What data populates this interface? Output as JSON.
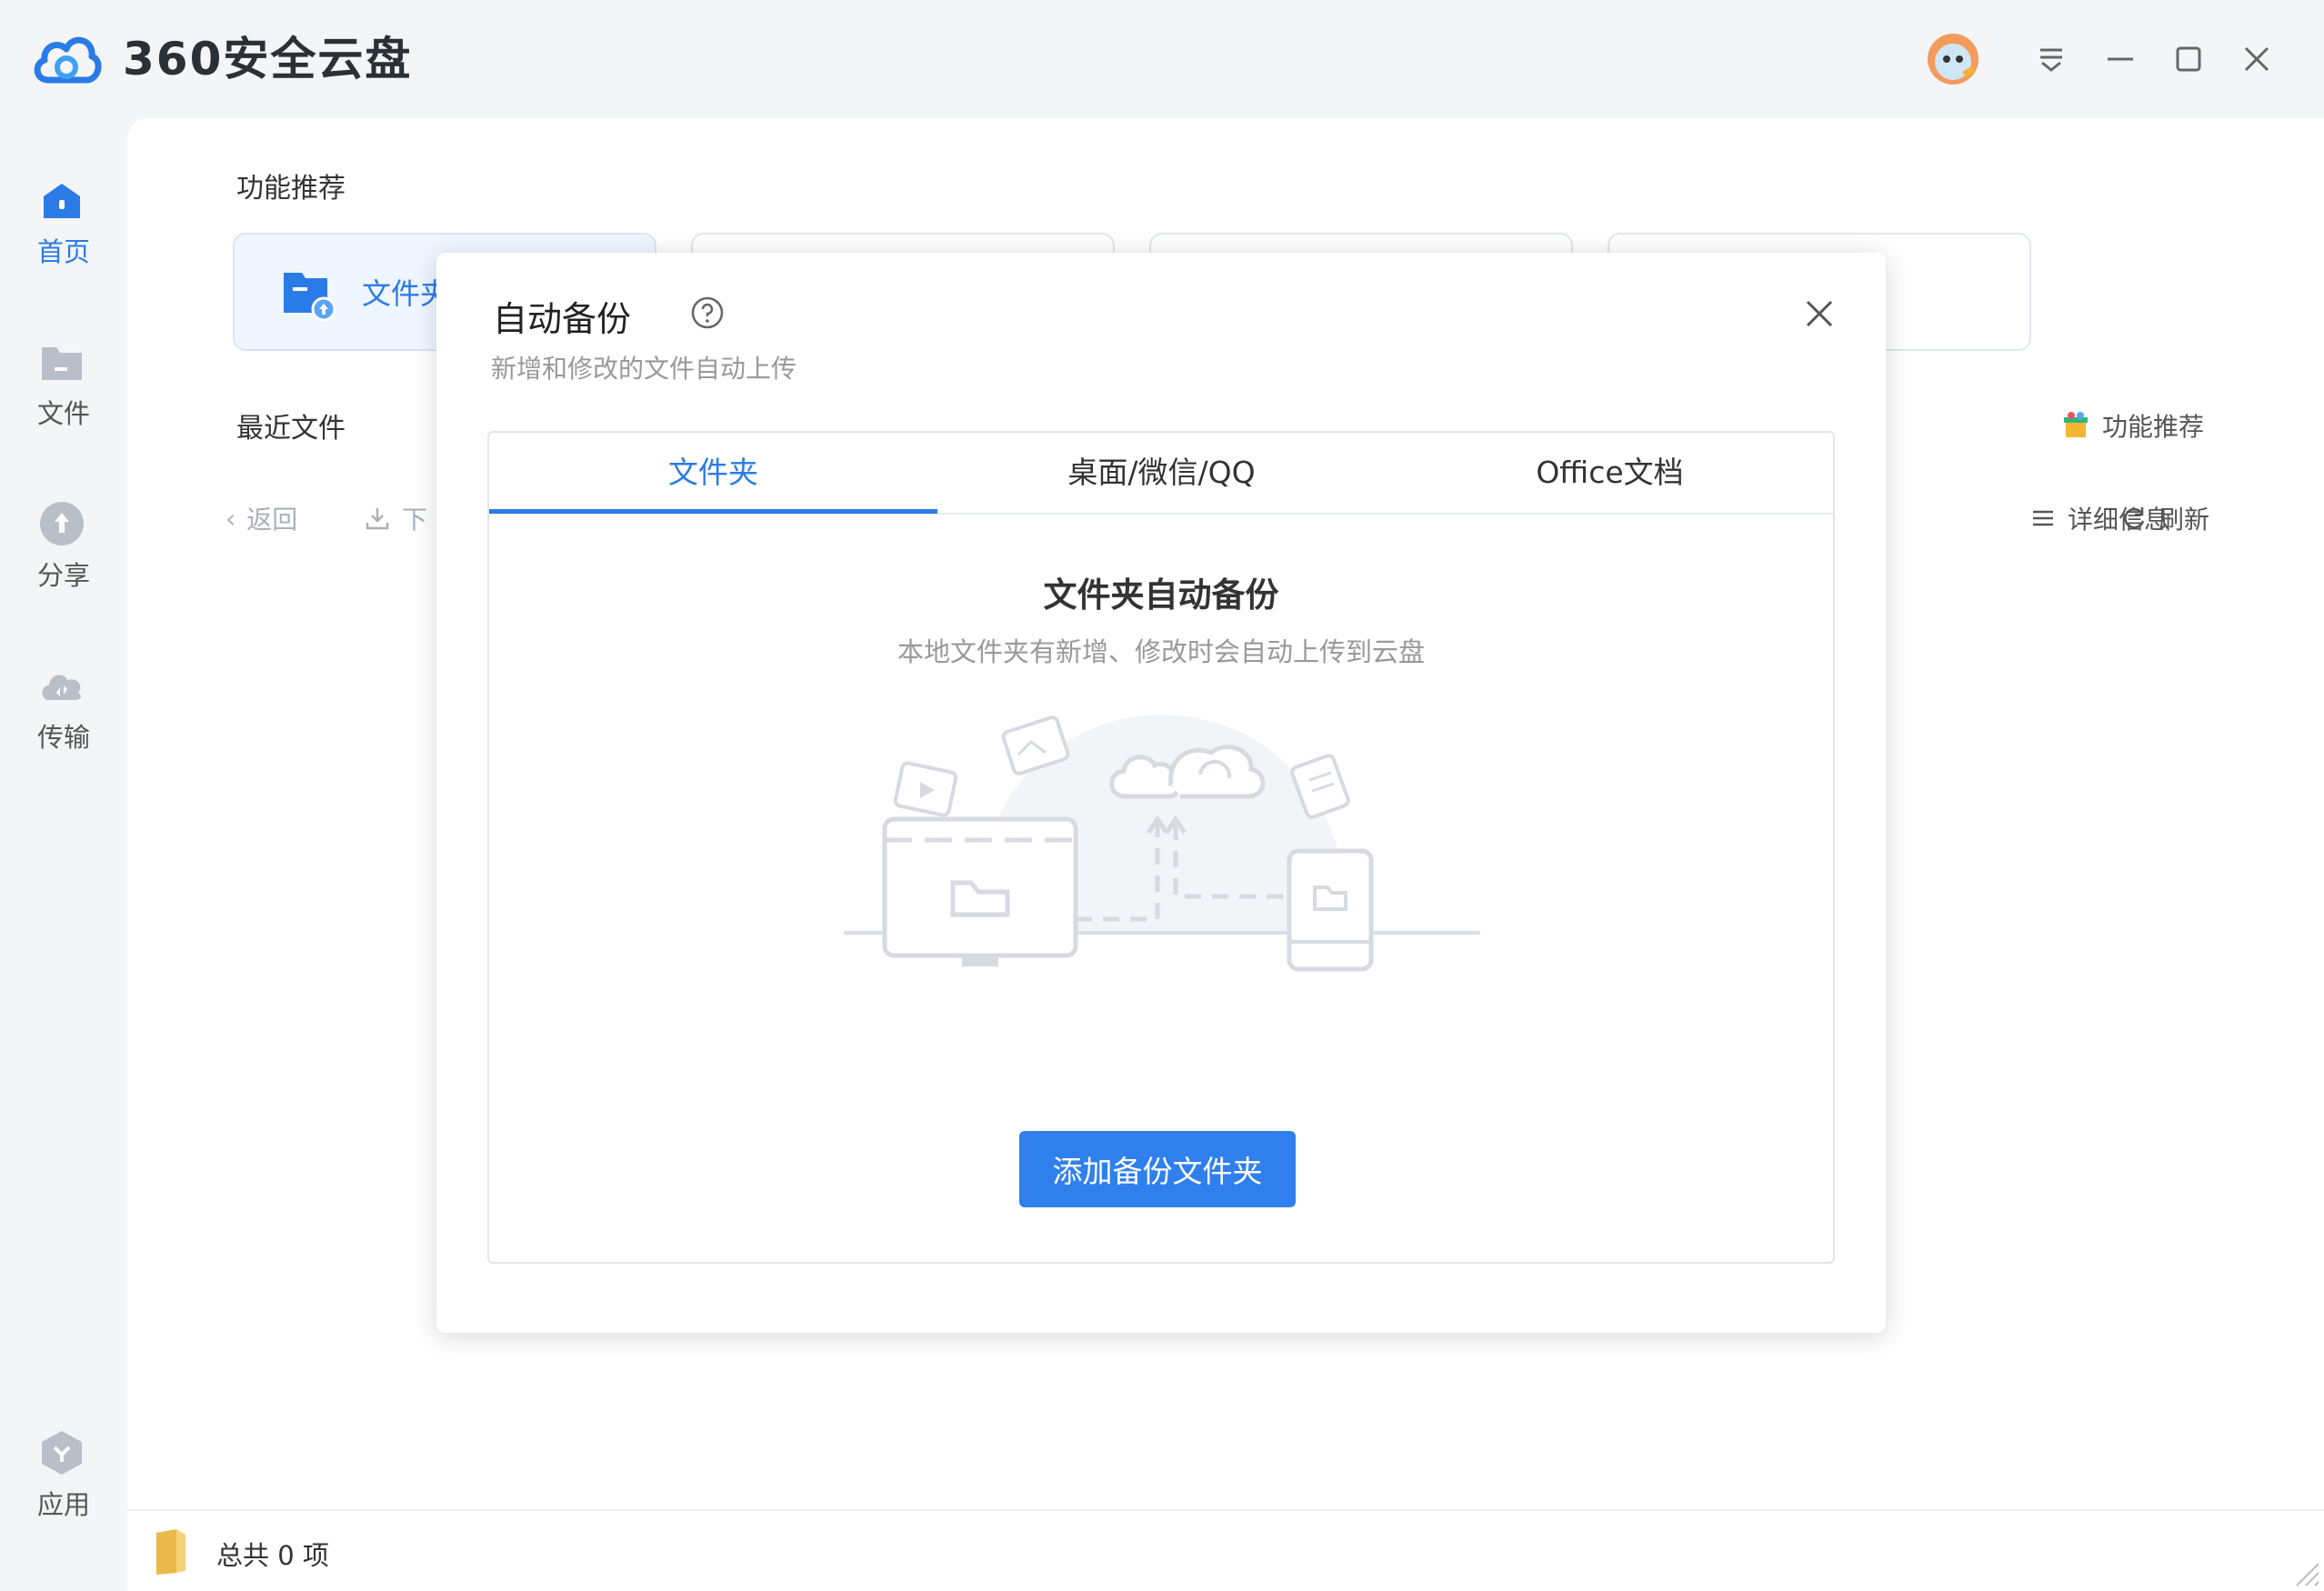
{
  "app": {
    "title": "360安全云盘"
  },
  "window_controls": {
    "avatar_icon": "avatar-icon",
    "menu_icon": "menu-icon",
    "minimize_icon": "minimize-icon",
    "maximize_icon": "maximize-icon",
    "close_icon": "close-icon"
  },
  "sidebar": {
    "items": [
      {
        "label": "首页",
        "icon": "home-icon",
        "active": true
      },
      {
        "label": "文件",
        "icon": "folder-icon",
        "active": false
      },
      {
        "label": "分享",
        "icon": "share-icon",
        "active": false
      },
      {
        "label": "传输",
        "icon": "transfer-icon",
        "active": false
      },
      {
        "label": "应用",
        "icon": "apps-icon",
        "active": false
      }
    ]
  },
  "main": {
    "features_title": "功能推荐",
    "feature_card_label": "文件夹",
    "recent_title": "最近文件",
    "feature_link": "功能推荐",
    "toolbar": {
      "back": "返回",
      "download": "下",
      "details": "详细信息",
      "refresh": "刷新"
    }
  },
  "status": {
    "total": "总共 0 项"
  },
  "dialog": {
    "title": "自动备份",
    "subtitle": "新增和修改的文件自动上传",
    "tabs": [
      "文件夹",
      "桌面/微信/QQ",
      "Office文档"
    ],
    "active_tab": 0,
    "panel_title": "文件夹自动备份",
    "panel_desc": "本地文件夹有新增、修改时会自动上传到云盘",
    "button": "添加备份文件夹"
  },
  "colors": {
    "accent": "#2b7be7",
    "button": "#2f80ed"
  }
}
